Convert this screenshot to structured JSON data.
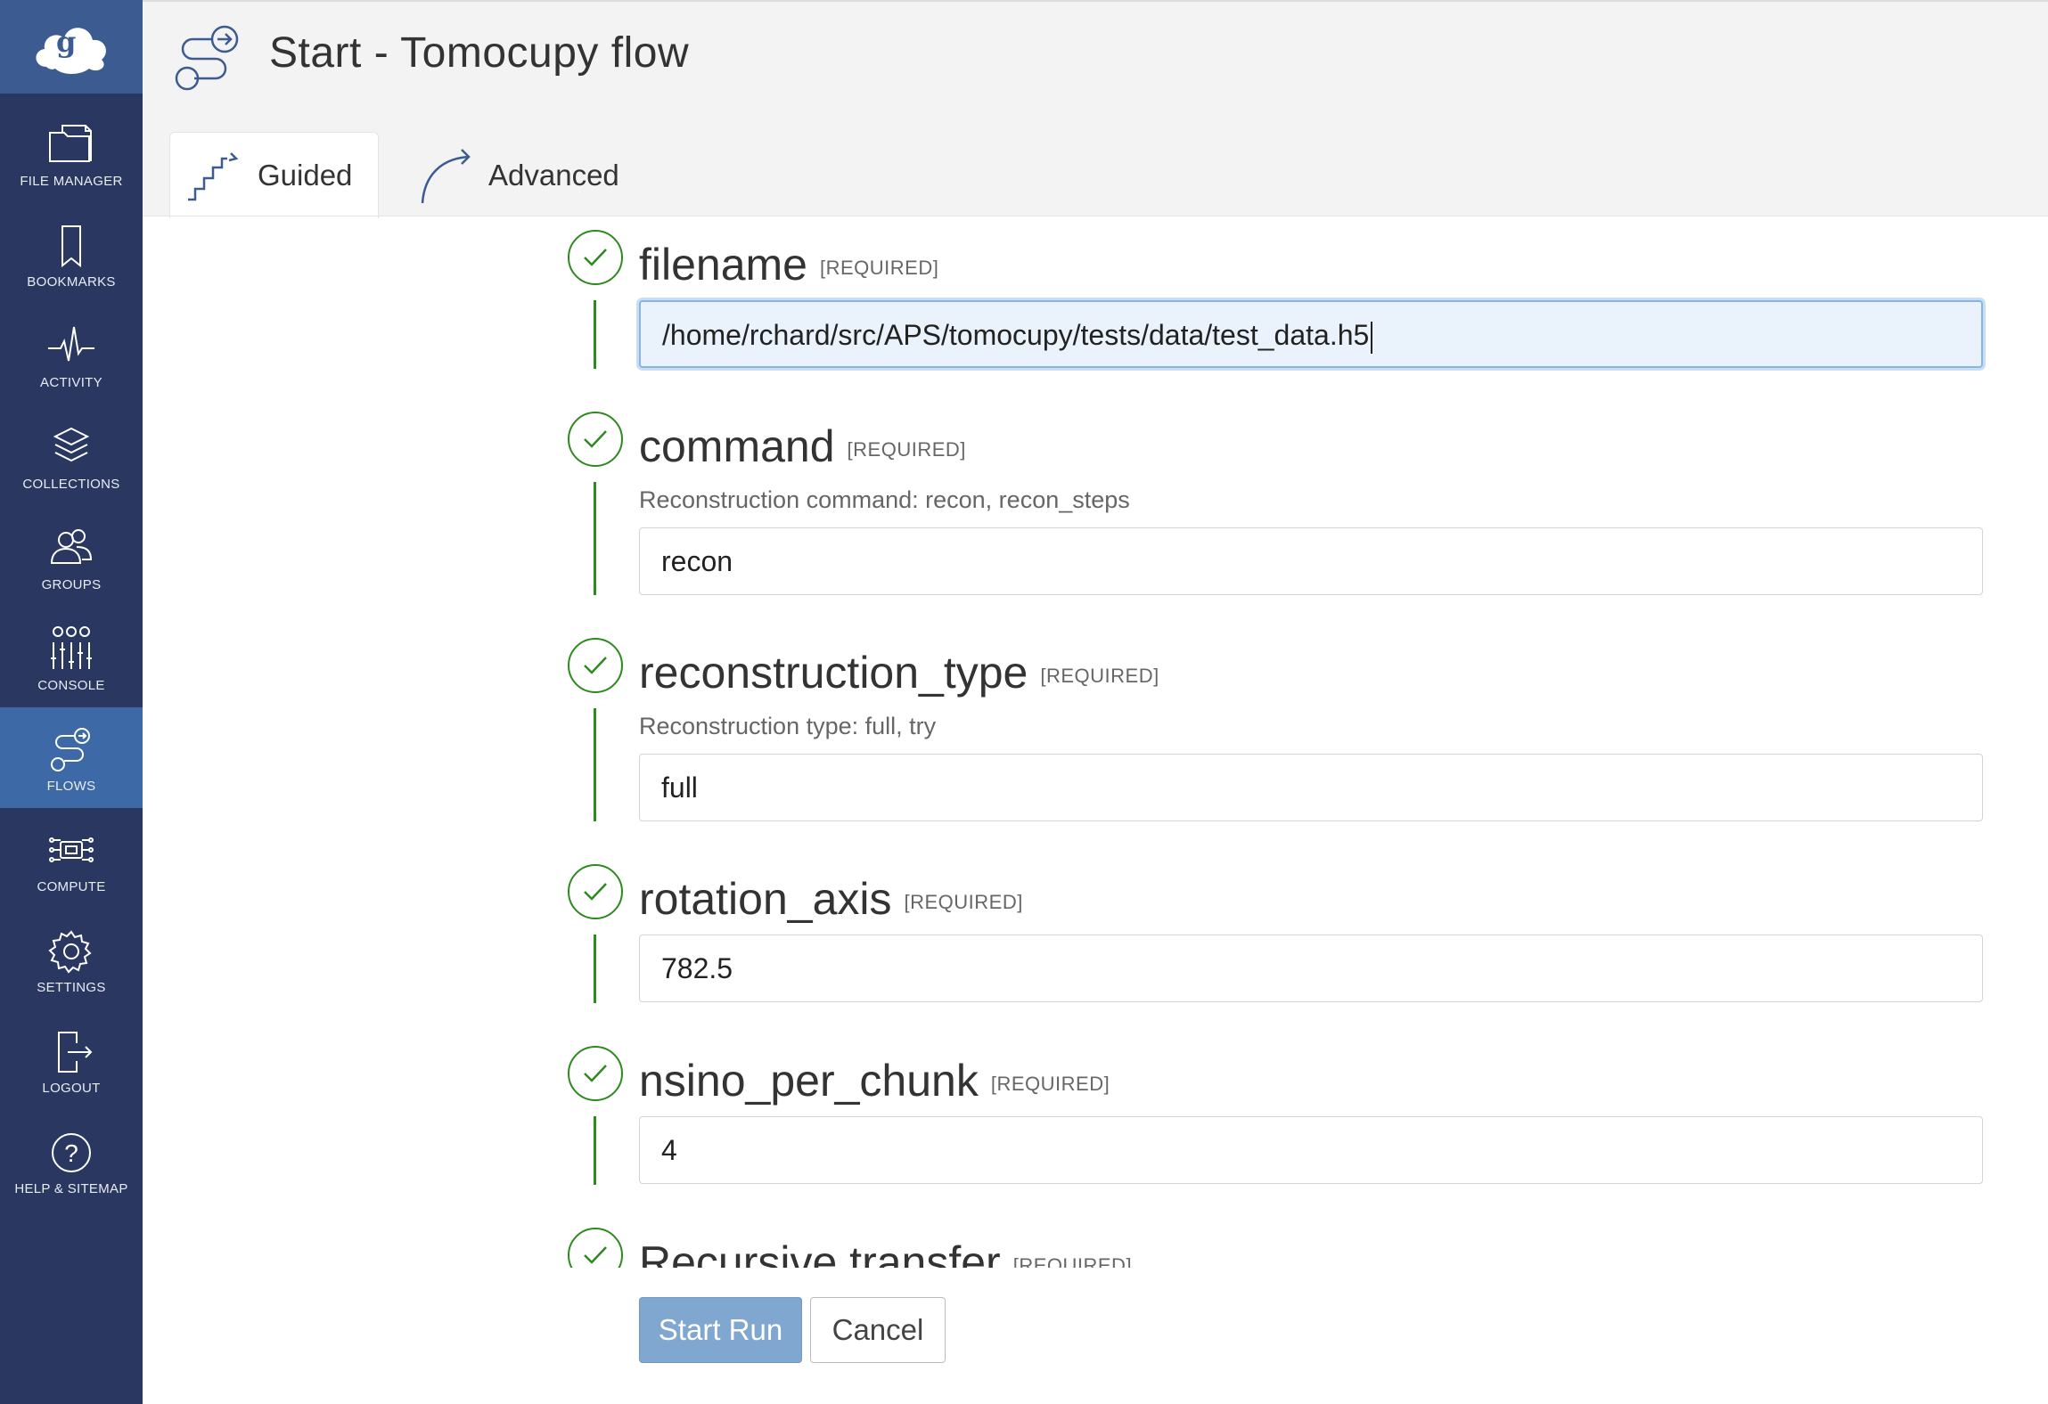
{
  "sidebar": {
    "items": [
      {
        "label": "FILE MANAGER",
        "icon": "file-manager-icon"
      },
      {
        "label": "BOOKMARKS",
        "icon": "bookmark-icon"
      },
      {
        "label": "ACTIVITY",
        "icon": "activity-icon"
      },
      {
        "label": "COLLECTIONS",
        "icon": "collections-icon"
      },
      {
        "label": "GROUPS",
        "icon": "groups-icon"
      },
      {
        "label": "CONSOLE",
        "icon": "console-icon"
      },
      {
        "label": "FLOWS",
        "icon": "flows-icon",
        "active": true
      },
      {
        "label": "COMPUTE",
        "icon": "compute-icon"
      },
      {
        "label": "SETTINGS",
        "icon": "settings-icon"
      },
      {
        "label": "LOGOUT",
        "icon": "logout-icon"
      },
      {
        "label": "HELP & SITEMAP",
        "icon": "help-icon"
      }
    ]
  },
  "header": {
    "title": "Start - Tomocupy flow",
    "tabs": [
      {
        "label": "Guided",
        "active": true
      },
      {
        "label": "Advanced",
        "active": false
      }
    ]
  },
  "form": {
    "required_tag": "[REQUIRED]",
    "fields": [
      {
        "name": "filename",
        "help": "",
        "value": "/home/rchard/src/APS/tomocupy/tests/data/test_data.h5"
      },
      {
        "name": "command",
        "help": "Reconstruction command: recon, recon_steps",
        "value": "recon"
      },
      {
        "name": "reconstruction_type",
        "help": "Reconstruction type: full, try",
        "value": "full"
      },
      {
        "name": "rotation_axis",
        "help": "",
        "value": "782.5"
      },
      {
        "name": "nsino_per_chunk",
        "help": "",
        "value": "4"
      },
      {
        "name": "Recursive transfer",
        "help": "",
        "value": ""
      }
    ]
  },
  "actions": {
    "start_label": "Start Run",
    "cancel_label": "Cancel"
  },
  "colors": {
    "sidebar": "#2a3760",
    "sidebar_active": "#3d6aa6",
    "check_green": "#2e8a1f",
    "start_button": "#7fa7cf"
  }
}
